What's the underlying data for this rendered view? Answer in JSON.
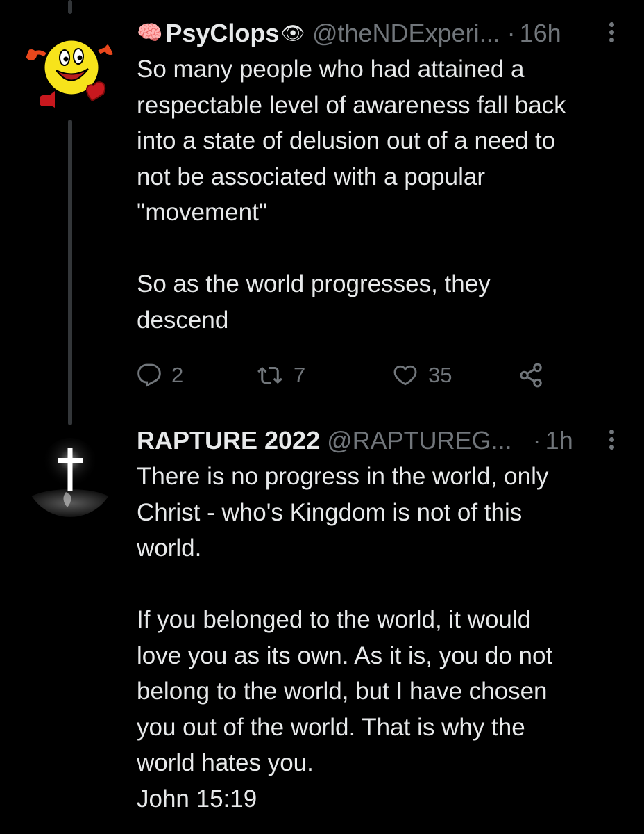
{
  "tweets": [
    {
      "name": "PsyClops",
      "name_prefix_emoji": "🧠",
      "name_suffix_emoji": "👁",
      "handle": "@theNDExperi...",
      "dot": "·",
      "time": "16h",
      "text": "So many people who had attained a\nrespectable level of awareness fall back\ninto a state of delusion out of a need to\nnot be associated with a popular\n\"movement\"\n\nSo as the world progresses, they\ndescend",
      "avatar_icon": "pacman-character-avatar",
      "actions": {
        "reply_count": "2",
        "retweet_count": "7",
        "like_count": "35"
      }
    },
    {
      "name": "RAPTURE 2022",
      "handle": "@RAPTUREG...",
      "dot": "·",
      "time": "1h",
      "text": "There is no progress in the world, only\nChrist - who's Kingdom is not of this\nworld.\n\nIf you belonged to the world, it would\nlove you as its own. As it is, you do not\nbelong to the world, but I have chosen\nyou out of the world. That is why the\nworld hates you.\nJohn 15:19",
      "avatar_icon": "glowing-cross-avatar"
    }
  ],
  "colors": {
    "background": "#000000",
    "primary_text": "#e7e9ea",
    "secondary_text": "#71767b",
    "thread_line": "#333639"
  }
}
